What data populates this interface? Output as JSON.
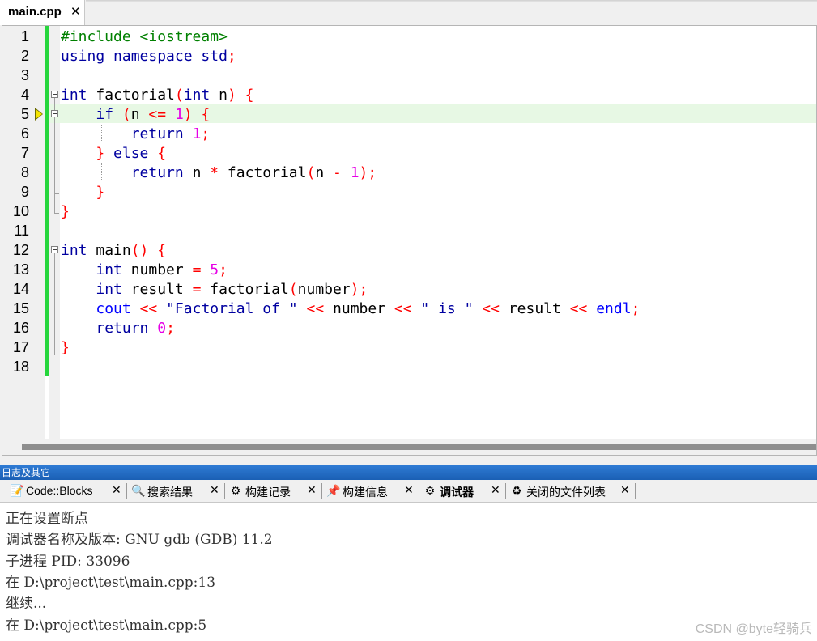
{
  "editor_tab": {
    "label": "main.cpp",
    "close": "✕"
  },
  "code_lines": [
    {
      "n": "1",
      "tokens": [
        [
          "pp",
          "#include <iostream>"
        ]
      ]
    },
    {
      "n": "2",
      "tokens": [
        [
          "kw",
          "using namespace std"
        ],
        [
          "op",
          ";"
        ]
      ]
    },
    {
      "n": "3",
      "tokens": []
    },
    {
      "n": "4",
      "tokens": [
        [
          "kw",
          "int"
        ],
        [
          "",
          " factorial"
        ],
        [
          "br",
          "("
        ],
        [
          "kw",
          "int"
        ],
        [
          "",
          " n"
        ],
        [
          "br",
          ")"
        ],
        [
          "",
          " "
        ],
        [
          "br",
          "{"
        ]
      ]
    },
    {
      "n": "5",
      "tokens": [
        [
          "",
          "    "
        ],
        [
          "kw",
          "if"
        ],
        [
          "",
          " "
        ],
        [
          "br",
          "("
        ],
        [
          "",
          "n "
        ],
        [
          "op",
          "<="
        ],
        [
          "",
          " "
        ],
        [
          "num",
          "1"
        ],
        [
          "br",
          ")"
        ],
        [
          "",
          " "
        ],
        [
          "br",
          "{"
        ]
      ]
    },
    {
      "n": "6",
      "tokens": [
        [
          "",
          "        "
        ],
        [
          "kw",
          "return"
        ],
        [
          "",
          " "
        ],
        [
          "num",
          "1"
        ],
        [
          "op",
          ";"
        ]
      ]
    },
    {
      "n": "7",
      "tokens": [
        [
          "",
          "    "
        ],
        [
          "br",
          "}"
        ],
        [
          "",
          " "
        ],
        [
          "kw",
          "else"
        ],
        [
          "",
          " "
        ],
        [
          "br",
          "{"
        ]
      ]
    },
    {
      "n": "8",
      "tokens": [
        [
          "",
          "        "
        ],
        [
          "kw",
          "return"
        ],
        [
          "",
          " n "
        ],
        [
          "op",
          "*"
        ],
        [
          "",
          " factorial"
        ],
        [
          "br",
          "("
        ],
        [
          "",
          "n "
        ],
        [
          "op",
          "-"
        ],
        [
          "",
          " "
        ],
        [
          "num",
          "1"
        ],
        [
          "br",
          ")"
        ],
        [
          "op",
          ";"
        ]
      ]
    },
    {
      "n": "9",
      "tokens": [
        [
          "",
          "    "
        ],
        [
          "br",
          "}"
        ]
      ]
    },
    {
      "n": "10",
      "tokens": [
        [
          "br",
          "}"
        ]
      ]
    },
    {
      "n": "11",
      "tokens": []
    },
    {
      "n": "12",
      "tokens": [
        [
          "kw",
          "int"
        ],
        [
          "",
          " main"
        ],
        [
          "br",
          "()"
        ],
        [
          "",
          " "
        ],
        [
          "br",
          "{"
        ]
      ]
    },
    {
      "n": "13",
      "tokens": [
        [
          "",
          "    "
        ],
        [
          "kw",
          "int"
        ],
        [
          "",
          " number "
        ],
        [
          "op",
          "="
        ],
        [
          "",
          " "
        ],
        [
          "num",
          "5"
        ],
        [
          "op",
          ";"
        ]
      ]
    },
    {
      "n": "14",
      "tokens": [
        [
          "",
          "    "
        ],
        [
          "kw",
          "int"
        ],
        [
          "",
          " result "
        ],
        [
          "op",
          "="
        ],
        [
          "",
          " factorial"
        ],
        [
          "br",
          "("
        ],
        [
          "",
          "number"
        ],
        [
          "br",
          ")"
        ],
        [
          "op",
          ";"
        ]
      ]
    },
    {
      "n": "15",
      "tokens": [
        [
          "",
          "    "
        ],
        [
          "str",
          "cout"
        ],
        [
          "",
          " "
        ],
        [
          "op",
          "<<"
        ],
        [
          "",
          " "
        ],
        [
          "kw",
          "\"Factorial of \""
        ],
        [
          "",
          " "
        ],
        [
          "op",
          "<<"
        ],
        [
          "",
          " number "
        ],
        [
          "op",
          "<<"
        ],
        [
          "",
          " "
        ],
        [
          "kw",
          "\" is \""
        ],
        [
          "",
          " "
        ],
        [
          "op",
          "<<"
        ],
        [
          "",
          " result "
        ],
        [
          "op",
          "<<"
        ],
        [
          "",
          " "
        ],
        [
          "str",
          "endl"
        ],
        [
          "op",
          ";"
        ]
      ]
    },
    {
      "n": "16",
      "tokens": [
        [
          "",
          "    "
        ],
        [
          "kw",
          "return"
        ],
        [
          "",
          " "
        ],
        [
          "num",
          "0"
        ],
        [
          "op",
          ";"
        ]
      ]
    },
    {
      "n": "17",
      "tokens": [
        [
          "br",
          "}"
        ]
      ]
    },
    {
      "n": "18",
      "tokens": []
    }
  ],
  "logs_panel": {
    "title": "日志及其它",
    "tabs": [
      {
        "label": "Code::Blocks",
        "icon": "notepad-icon",
        "glyph": "📝",
        "active": false
      },
      {
        "label": "搜索结果",
        "icon": "magnifier-icon",
        "glyph": "🔍",
        "active": false
      },
      {
        "label": "构建记录",
        "icon": "gear-icon",
        "glyph": "⚙",
        "active": false
      },
      {
        "label": "构建信息",
        "icon": "pin-icon",
        "glyph": "📌",
        "active": false
      },
      {
        "label": "调试器",
        "icon": "gear-icon",
        "glyph": "⚙",
        "active": true
      },
      {
        "label": "关闭的文件列表",
        "icon": "recycle-icon",
        "glyph": "♻",
        "active": false
      }
    ],
    "close_glyph": "✕",
    "log_lines": [
      "正在设置断点",
      "调试器名称及版本: GNU gdb (GDB) 11.2",
      "子进程 PID: 33096",
      "在 D:\\project\\test\\main.cpp:13",
      "继续...",
      "在 D:\\project\\test\\main.cpp:5"
    ]
  },
  "watermark": "CSDN @byte轻骑兵",
  "colors": {
    "keyword": "#0000a0",
    "preprocessor": "#008000",
    "bracket": "#ff0000",
    "number": "#e600e6",
    "builtin": "#0000ff",
    "changebar": "#26d63c",
    "current_line": "#e7f8e4",
    "panel_title": "#1a5fb4"
  }
}
